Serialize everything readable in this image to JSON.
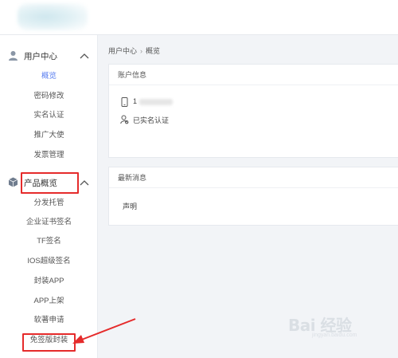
{
  "sidebar": {
    "groups": [
      {
        "label": "用户中心",
        "icon": "user-icon",
        "expanded": true,
        "items": [
          "概览",
          "密码修改",
          "实名认证",
          "推广大使",
          "发票管理"
        ]
      },
      {
        "label": "产品概览",
        "icon": "cube-icon",
        "expanded": true,
        "items": [
          "分发托管",
          "企业证书签名",
          "TF签名",
          "IOS超级签名",
          "封装APP",
          "APP上架",
          "软著申请",
          "免签版封装"
        ]
      }
    ],
    "active_item": "概览"
  },
  "breadcrumb": {
    "home": "用户中心",
    "separator": "›",
    "current": "概览"
  },
  "account_card": {
    "title": "账户信息",
    "phone_prefix": "1",
    "verification_status": "已实名认证"
  },
  "news_card": {
    "title": "最新消息",
    "item": "声明"
  },
  "annotations": {
    "highlight_color": "#e52b2b"
  },
  "watermark": {
    "text": "Bai 经验",
    "sub": "jingyan.baidu.com"
  },
  "colors": {
    "accent": "#5b7ff0",
    "background": "#f2f4f7",
    "annotation": "#e52b2b"
  }
}
